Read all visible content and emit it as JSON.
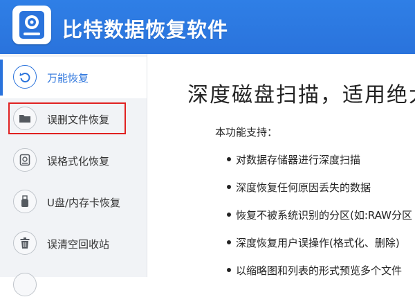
{
  "app": {
    "title": "比特数据恢复软件"
  },
  "sidebar": {
    "items": [
      {
        "label": "万能恢复",
        "icon": "undo-icon",
        "active": true
      },
      {
        "label": "误删文件恢复",
        "icon": "folder-icon",
        "active": false,
        "highlighted": true
      },
      {
        "label": "误格式化恢复",
        "icon": "disk-icon",
        "active": false
      },
      {
        "label": "U盘/内存卡恢复",
        "icon": "usb-drive-icon",
        "active": false
      },
      {
        "label": "误清空回收站",
        "icon": "trash-icon",
        "active": false
      }
    ]
  },
  "main": {
    "title": "深度磁盘扫描，适用绝大",
    "intro": "本功能支持：",
    "features": [
      "对数据存储器进行深度扫描",
      "深度恢复任何原因丢失的数据",
      "恢复不被系统识别的分区(如:RAW分区",
      "深度恢复用户误操作(格式化、删除)",
      "以缩略图和列表的形式预览多个文件"
    ]
  },
  "colors": {
    "accent": "#2a73dc",
    "header": "#2f7fe6",
    "highlight": "#e02020",
    "sidebar_bg": "#f1f3f6"
  }
}
